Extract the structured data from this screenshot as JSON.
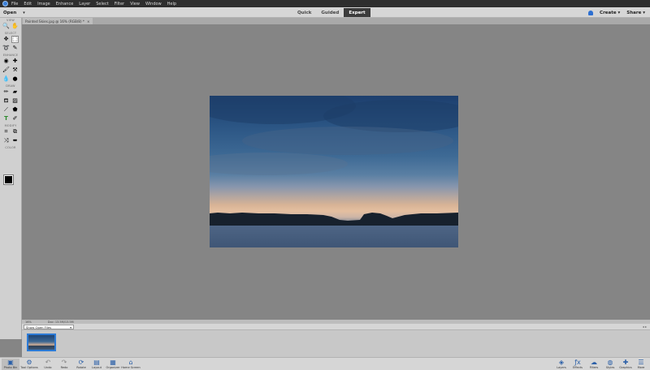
{
  "menubar": {
    "items": [
      "File",
      "Edit",
      "Image",
      "Enhance",
      "Layer",
      "Select",
      "Filter",
      "View",
      "Window",
      "Help"
    ]
  },
  "modebar": {
    "open_label": "Open",
    "modes": [
      "Quick",
      "Guided",
      "Expert"
    ],
    "active_mode": "Expert",
    "create_label": "Create",
    "share_label": "Share"
  },
  "document": {
    "tab_title": "Painted Skies.jpg @ 16% (RGB/8) *",
    "close_glyph": "×"
  },
  "toolbox": {
    "sections": {
      "view": "VIEW",
      "select": "SELECT",
      "enhance": "ENHANCE",
      "draw": "DRAW",
      "modify": "MODIFY",
      "color": "COLOR"
    }
  },
  "statusbar": {
    "zoom": "16%",
    "doc_info": "Doc: 13.5M/13.5M"
  },
  "photobin": {
    "select_value": "Show Open Files"
  },
  "bottombar": {
    "left": [
      {
        "label": "Photo Bin",
        "icon": "photo-bin-icon"
      },
      {
        "label": "Tool Options",
        "icon": "tool-options-icon"
      },
      {
        "label": "Undo",
        "icon": "undo-icon"
      },
      {
        "label": "Redo",
        "icon": "redo-icon"
      },
      {
        "label": "Rotate",
        "icon": "rotate-icon"
      },
      {
        "label": "Layout",
        "icon": "layout-icon"
      },
      {
        "label": "Organizer",
        "icon": "organizer-icon"
      },
      {
        "label": "Home Screen",
        "icon": "home-icon"
      }
    ],
    "right": [
      {
        "label": "Layers",
        "icon": "layers-icon"
      },
      {
        "label": "Effects",
        "icon": "effects-icon"
      },
      {
        "label": "Filters",
        "icon": "filters-icon"
      },
      {
        "label": "Styles",
        "icon": "styles-icon"
      },
      {
        "label": "Graphics",
        "icon": "graphics-icon"
      },
      {
        "label": "More",
        "icon": "more-icon"
      }
    ]
  },
  "colors": {
    "accent": "#2d6fd1",
    "foreground_color": "#000000",
    "background_color": "#ffffff"
  }
}
